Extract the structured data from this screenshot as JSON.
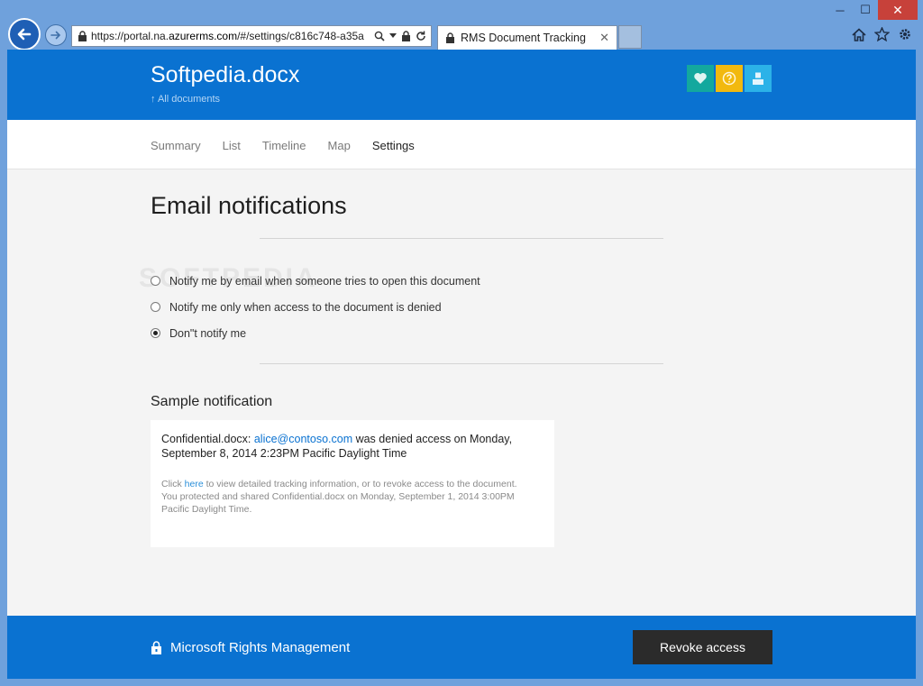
{
  "browser": {
    "url_prefix": "https://portal.na.",
    "url_domain": "azurerms.com",
    "url_rest": "/#/settings/c816c748-a35a",
    "tab_title": "RMS Document Tracking",
    "tab_close": "✕",
    "win_minimize": "─",
    "win_maximize": "☐",
    "win_close": "✕"
  },
  "header": {
    "doc_title": "Softpedia.docx",
    "back_link": "↑ All documents"
  },
  "subnav": {
    "items": [
      "Summary",
      "List",
      "Timeline",
      "Map",
      "Settings"
    ],
    "active": "Settings"
  },
  "email_notifications": {
    "title": "Email notifications",
    "options": [
      "Notify me by email when someone tries to open this document",
      "Notify me only when access to the document is denied",
      "Don\"t notify me"
    ],
    "selected_index": 2
  },
  "sample": {
    "title": "Sample notification",
    "main_prefix": "Confidential.docx: ",
    "main_email": "alice@contoso.com",
    "main_suffix": " was denied access on Monday, September 8, 2014 2:23PM Pacific Daylight Time",
    "sub_prefix": "Click ",
    "sub_link": "here",
    "sub_suffix": " to view detailed tracking information, or to revoke access to the document.",
    "sub_line2": "You protected and shared Confidential.docx on Monday, September 1, 2014 3:00PM Pacific Daylight Time."
  },
  "footer": {
    "brand": "Microsoft Rights Management",
    "revoke_label": "Revoke access"
  },
  "colors": {
    "brand_blue": "#0a72d1",
    "tile_teal": "#13a89e",
    "tile_yellow": "#f2b90f",
    "tile_cyan": "#2bb2e8"
  },
  "icons": {
    "tile_1": "heart-icon",
    "tile_2": "help-icon",
    "tile_3": "user-icon"
  },
  "watermark": "SOFTPEDIA"
}
